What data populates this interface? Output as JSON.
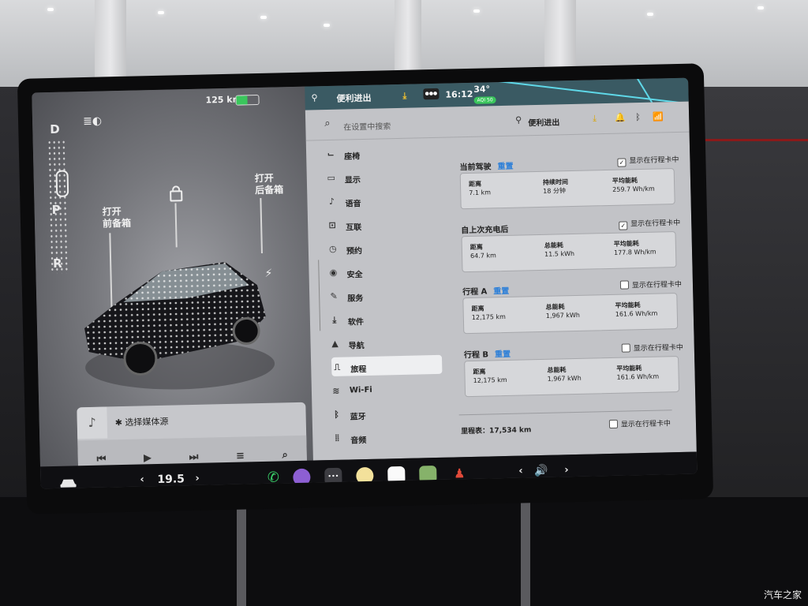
{
  "status": {
    "range": "125 km",
    "user": "便利进出",
    "time": "16:12",
    "temperature": "34°",
    "aqi": "AQI 50"
  },
  "car": {
    "gears": [
      "D",
      "P",
      "R"
    ],
    "frunk_label": [
      "打开",
      "前备箱"
    ],
    "trunk_label": [
      "打开",
      "后备箱"
    ]
  },
  "media": {
    "source_label": "✱ 选择媒体源",
    "controls": [
      "⏮",
      "▶",
      "⏭",
      "≡",
      "⌕"
    ]
  },
  "settings": {
    "search_placeholder": "在设置中搜索",
    "profile": "便利进出",
    "nav": [
      {
        "icon": "seat-icon",
        "glyph": "⌙",
        "label": "座椅"
      },
      {
        "icon": "display-icon",
        "glyph": "▭",
        "label": "显示"
      },
      {
        "icon": "voice-icon",
        "glyph": "♪",
        "label": "语音"
      },
      {
        "icon": "connect-icon",
        "glyph": "⊡",
        "label": "互联"
      },
      {
        "icon": "schedule-icon",
        "glyph": "◷",
        "label": "预约"
      },
      {
        "icon": "safety-icon",
        "glyph": "◉",
        "label": "安全"
      },
      {
        "icon": "service-icon",
        "glyph": "✎",
        "label": "服务"
      },
      {
        "icon": "software-icon",
        "glyph": "⤓",
        "label": "软件"
      },
      {
        "icon": "navigation-icon",
        "glyph": "▲",
        "label": "导航"
      },
      {
        "icon": "trips-icon",
        "glyph": "⎍",
        "label": "旅程"
      },
      {
        "icon": "wifi-icon",
        "glyph": "≋",
        "label": "Wi-Fi"
      },
      {
        "icon": "bluetooth-icon",
        "glyph": "ᛒ",
        "label": "蓝牙"
      },
      {
        "icon": "audio-icon",
        "glyph": "⦙⦙",
        "label": "音频"
      }
    ],
    "selected_nav": 9,
    "show_in_card": "显示在行程卡中",
    "reset": "重置",
    "trips": [
      {
        "title": "当前驾驶",
        "has_reset": true,
        "checked": true,
        "cells": [
          {
            "label": "距离",
            "value": "7.1 km"
          },
          {
            "label": "持续时间",
            "value": "18 分钟"
          },
          {
            "label": "平均能耗",
            "value": "259.7 Wh/km"
          }
        ]
      },
      {
        "title": "自上次充电后",
        "has_reset": false,
        "checked": true,
        "cells": [
          {
            "label": "距离",
            "value": "64.7 km"
          },
          {
            "label": "总能耗",
            "value": "11.5 kWh"
          },
          {
            "label": "平均能耗",
            "value": "177.8 Wh/km"
          }
        ]
      },
      {
        "title": "行程 A",
        "has_reset": true,
        "checked": false,
        "cells": [
          {
            "label": "距离",
            "value": "12,175 km"
          },
          {
            "label": "总能耗",
            "value": "1,967 kWh"
          },
          {
            "label": "平均能耗",
            "value": "161.6 Wh/km"
          }
        ]
      },
      {
        "title": "行程 B",
        "has_reset": true,
        "checked": false,
        "cells": [
          {
            "label": "距离",
            "value": "12,175 km"
          },
          {
            "label": "总能耗",
            "value": "1,967 kWh"
          },
          {
            "label": "平均能耗",
            "value": "161.6 Wh/km"
          }
        ]
      }
    ],
    "odometer": "里程表：17,534 km"
  },
  "dock": {
    "temp": "19.5",
    "left_arrow": "‹",
    "right_arrow": "›",
    "vol_left": "‹",
    "vol_right": "›",
    "volume": "🔊"
  },
  "watermark": "汽车之家"
}
